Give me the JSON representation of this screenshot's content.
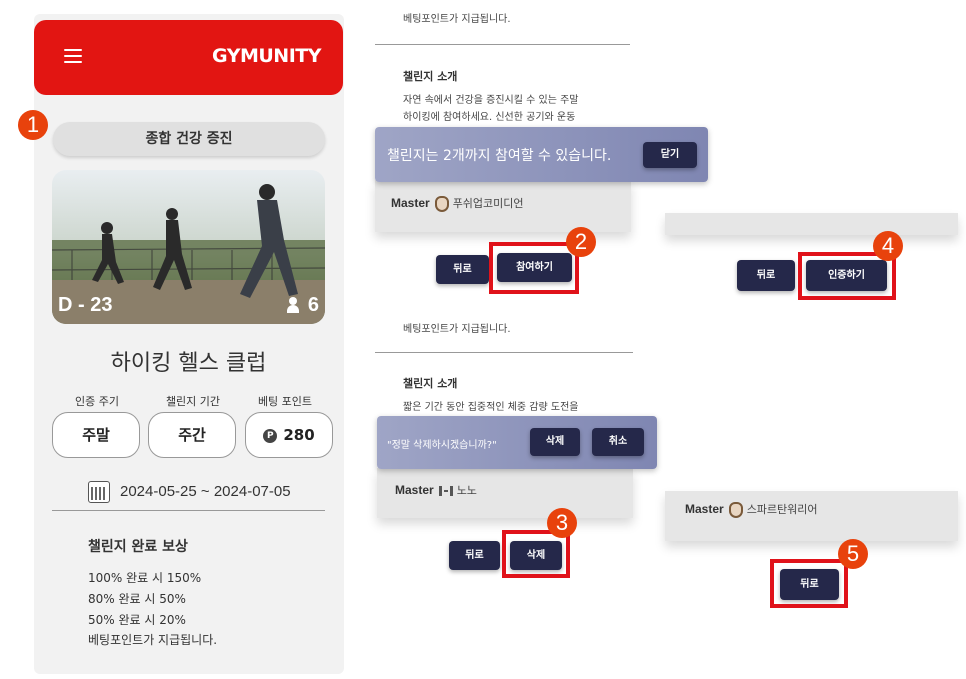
{
  "app": {
    "logo": "GYMUNITY",
    "challenge_category": "종합 건강 증진",
    "hero": {
      "dday": "D - 23",
      "participants": "6"
    },
    "club_name": "하이킹 헬스 클럽",
    "stats": [
      {
        "label": "인증 주기",
        "value": "주말"
      },
      {
        "label": "챌린지 기간",
        "value": "주간"
      },
      {
        "label": "베팅 포인트",
        "value": "280",
        "icon": "P"
      }
    ],
    "date_range": "2024-05-25 ~ 2024-07-05",
    "reward": {
      "title": "챌린지 완료 보상",
      "lines": [
        "100% 완료 시 150%",
        "80% 완료 시 50%",
        "50% 완료 시 20%",
        "베팅포인트가 지급됩니다."
      ]
    }
  },
  "steps": [
    "1",
    "2",
    "3",
    "4",
    "5"
  ],
  "panel2": {
    "top_text": "베팅포인트가 지급됩니다.",
    "section_title": "챌린지 소개",
    "desc_lines": [
      "자연 속에서 건강을 증진시킬 수 있는 주말",
      "하이킹에 참여하세요. 신선한 공기와 운동"
    ],
    "modal_text": "챌린지는 2개까지 참여할 수 있습니다.",
    "modal_btn": "닫기",
    "master_label": "Master",
    "master_name": "푸쉬업코미디언",
    "back_btn": "뒤로",
    "join_btn": "참여하기"
  },
  "panel3": {
    "top_text": "베팅포인트가 지급됩니다.",
    "section_title": "챌린지 소개",
    "desc_line": "짧은 기간 동안 집중적인 체중 감량 도전을",
    "modal_text": "\"정말 삭제하시겠습니까?\"",
    "delete_btn": "삭제",
    "cancel_btn": "취소",
    "master_label": "Master",
    "master_name": "노노",
    "back_btn": "뒤로",
    "delete_main_btn": "삭제"
  },
  "panel4": {
    "back_btn": "뒤로",
    "verify_btn": "인증하기"
  },
  "panel5": {
    "master_label": "Master",
    "master_name": "스파르탄워리어",
    "back_btn": "뒤로"
  }
}
